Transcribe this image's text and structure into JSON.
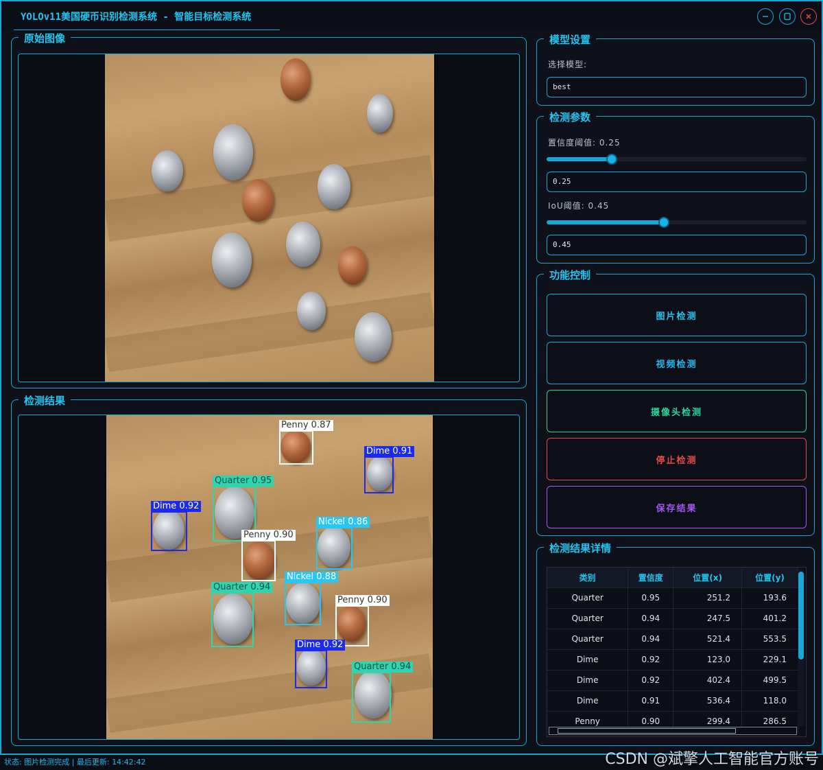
{
  "window": {
    "title": "YOLOv11美国硬币识别检测系统 - 智能目标检测系统"
  },
  "panels": {
    "original": "原始图像",
    "result": "检测结果",
    "model": "模型设置",
    "params": "检测参数",
    "controls": "功能控制",
    "details": "检测结果详情"
  },
  "model": {
    "select_label": "选择模型:",
    "selected": "best"
  },
  "params": {
    "conf_label": "置信度阈值: 0.25",
    "conf_value": "0.25",
    "conf_level": 0.25,
    "iou_label": "IoU阈值: 0.45",
    "iou_value": "0.45",
    "iou_level": 0.45
  },
  "buttons": {
    "image_detect": "图片检测",
    "video_detect": "视频检测",
    "camera_detect": "摄像头检测",
    "stop_detect": "停止检测",
    "save_result": "保存结果"
  },
  "detections": [
    {
      "label": "Penny 0.87",
      "color": "#ffffff",
      "text_color": "#333333"
    },
    {
      "label": "Dime 0.91",
      "color": "#1a2af0",
      "text_color": "#ffffff"
    },
    {
      "label": "Quarter 0.95",
      "color": "#2fd4b0",
      "text_color": "#1b4f45"
    },
    {
      "label": "Dime 0.92",
      "color": "#1a2af0",
      "text_color": "#ffffff"
    },
    {
      "label": "Nickel 0.86",
      "color": "#29c7f0",
      "text_color": "#ffffff"
    },
    {
      "label": "Penny 0.90",
      "color": "#ffffff",
      "text_color": "#333333"
    },
    {
      "label": "Nickel 0.88",
      "color": "#29c7f0",
      "text_color": "#ffffff"
    },
    {
      "label": "Quarter 0.94",
      "color": "#2fd4b0",
      "text_color": "#1b4f45"
    },
    {
      "label": "Penny 0.90",
      "color": "#ffffff",
      "text_color": "#333333"
    },
    {
      "label": "Dime 0.92",
      "color": "#1a2af0",
      "text_color": "#ffffff"
    },
    {
      "label": "Quarter 0.94",
      "color": "#2fd4b0",
      "text_color": "#1b4f45"
    }
  ],
  "table": {
    "headers": [
      "类别",
      "置信度",
      "位置(x)",
      "位置(y)"
    ],
    "rows": [
      [
        "Quarter",
        "0.95",
        "251.2",
        "193.6"
      ],
      [
        "Quarter",
        "0.94",
        "247.5",
        "401.2"
      ],
      [
        "Quarter",
        "0.94",
        "521.4",
        "553.5"
      ],
      [
        "Dime",
        "0.92",
        "123.0",
        "229.1"
      ],
      [
        "Dime",
        "0.92",
        "402.4",
        "499.5"
      ],
      [
        "Dime",
        "0.91",
        "536.4",
        "118.0"
      ],
      [
        "Penny",
        "0.90",
        "299.4",
        "286.5"
      ]
    ]
  },
  "status": {
    "text": "状态: 图片检测完成 | 最后更新: 14:42:42"
  },
  "watermark": "CSDN @斌擎人工智能官方账号",
  "colors": {
    "accent": "#1aa7d8",
    "title": "#22c4f2",
    "stop": "#e44b4b",
    "save": "#a855f7",
    "camera": "#2bd49a"
  },
  "icons": [
    "minimize-icon",
    "maximize-icon",
    "close-icon"
  ]
}
